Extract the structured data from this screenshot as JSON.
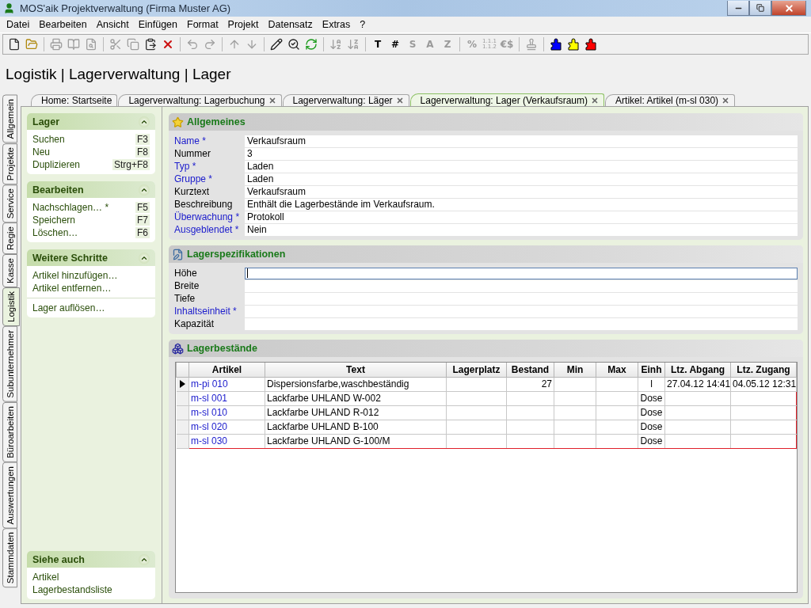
{
  "window": {
    "title": "MOS'aik Projektverwaltung (Firma Muster AG)"
  },
  "menu": [
    "Datei",
    "Bearbeiten",
    "Ansicht",
    "Einfügen",
    "Format",
    "Projekt",
    "Datensatz",
    "Extras",
    "?"
  ],
  "toolbar": {
    "groups": [
      [
        {
          "kind": "icon",
          "disabled": false
        },
        {
          "kind": "icon",
          "disabled": false
        }
      ],
      [
        {
          "kind": "icon",
          "disabled": true
        },
        {
          "kind": "icon",
          "disabled": true
        },
        {
          "kind": "icon",
          "disabled": true
        }
      ],
      [
        {
          "kind": "icon",
          "disabled": true
        },
        {
          "kind": "icon",
          "disabled": true
        },
        {
          "kind": "icon",
          "disabled": false
        },
        {
          "kind": "icon",
          "disabled": false
        }
      ],
      [
        {
          "kind": "icon",
          "disabled": true
        },
        {
          "kind": "icon",
          "disabled": true
        }
      ],
      [
        {
          "kind": "icon",
          "disabled": true
        },
        {
          "kind": "icon",
          "disabled": true
        }
      ],
      [
        {
          "kind": "icon",
          "disabled": false
        },
        {
          "kind": "icon",
          "disabled": false
        },
        {
          "kind": "icon",
          "disabled": false
        }
      ],
      [
        {
          "kind": "icon",
          "disabled": true
        },
        {
          "kind": "icon",
          "disabled": true
        }
      ],
      [
        {
          "kind": "glyph",
          "label": "T",
          "disabled": false
        },
        {
          "kind": "glyph",
          "label": "#",
          "disabled": false
        },
        {
          "kind": "glyph",
          "label": "S",
          "disabled": true
        },
        {
          "kind": "glyph",
          "label": "A",
          "disabled": true
        },
        {
          "kind": "glyph",
          "label": "Z",
          "disabled": true
        }
      ],
      [
        {
          "kind": "glyph",
          "label": "%",
          "disabled": true
        },
        {
          "kind": "glyph",
          "label": "1.1.1 1.1.2",
          "disabled": true
        },
        {
          "kind": "glyph",
          "label": "€$",
          "disabled": true
        }
      ],
      [
        {
          "kind": "icon",
          "disabled": true
        }
      ],
      [
        {
          "kind": "icon",
          "disabled": false,
          "color": "#0000ff"
        },
        {
          "kind": "icon",
          "disabled": false,
          "color": "#ffff00"
        },
        {
          "kind": "icon",
          "disabled": false,
          "color": "#ff0000"
        }
      ]
    ]
  },
  "breadcrumb": "Logistik | Lagerverwaltung | Lager",
  "side_tabs": [
    {
      "label": "Allgemein",
      "selected": false
    },
    {
      "label": "Projekte",
      "selected": false
    },
    {
      "label": "Service",
      "selected": false
    },
    {
      "label": "Regie",
      "selected": false
    },
    {
      "label": "Kasse",
      "selected": false
    },
    {
      "label": "Logistik",
      "selected": true
    },
    {
      "label": "Subunternehmer",
      "selected": false
    },
    {
      "label": "Büroarbeiten",
      "selected": false
    },
    {
      "label": "Auswertungen",
      "selected": false
    },
    {
      "label": "Stammdaten",
      "selected": false
    }
  ],
  "doc_tabs": [
    {
      "label": "Home: Startseite",
      "closable": false,
      "selected": false
    },
    {
      "label": "Lagerverwaltung: Lagerbuchung",
      "closable": true,
      "selected": false
    },
    {
      "label": "Lagerverwaltung: Läger",
      "closable": true,
      "selected": false
    },
    {
      "label": "Lagerverwaltung: Lager (Verkaufsraum)",
      "closable": true,
      "selected": true
    },
    {
      "label": "Artikel: Artikel (m-sl 030)",
      "closable": true,
      "selected": false
    }
  ],
  "task_panels": [
    {
      "title": "Lager",
      "expanded": true,
      "groups": [
        [
          {
            "label": "Suchen",
            "shortcut": "F3"
          },
          {
            "label": "Neu",
            "shortcut": "F8"
          },
          {
            "label": "Duplizieren",
            "shortcut": "Strg+F8"
          }
        ]
      ]
    },
    {
      "title": "Bearbeiten",
      "expanded": true,
      "groups": [
        [
          {
            "label": "Nachschlagen… *",
            "shortcut": "F5"
          },
          {
            "label": "Speichern",
            "shortcut": "F7"
          },
          {
            "label": "Löschen…",
            "shortcut": "F6"
          }
        ]
      ]
    },
    {
      "title": "Weitere Schritte",
      "expanded": true,
      "groups": [
        [
          {
            "label": "Artikel hinzufügen…"
          },
          {
            "label": "Artikel entfernen…"
          }
        ],
        [
          {
            "label": "Lager auflösen…"
          }
        ]
      ]
    }
  ],
  "see_also": {
    "title": "Siehe auch",
    "expanded": true,
    "groups": [
      [
        {
          "label": "Artikel"
        },
        {
          "label": "Lagerbestandsliste"
        }
      ]
    ]
  },
  "sections": [
    {
      "title": "Allgemeines",
      "fields": [
        {
          "label": "Name *",
          "required": true,
          "value": "Verkaufsraum"
        },
        {
          "label": "Nummer",
          "required": false,
          "value": "3"
        },
        {
          "label": "Typ *",
          "required": true,
          "value": "Laden"
        },
        {
          "label": "Gruppe *",
          "required": true,
          "value": "Laden"
        },
        {
          "label": "Kurztext",
          "required": false,
          "value": "Verkaufsraum"
        },
        {
          "label": "Beschreibung",
          "required": false,
          "value": "Enthält die Lagerbestände im Verkaufsraum."
        },
        {
          "label": "Überwachung *",
          "required": true,
          "value": "Protokoll"
        },
        {
          "label": "Ausgeblendet *",
          "required": true,
          "value": "Nein"
        }
      ]
    },
    {
      "title": "Lagerspezifikationen",
      "fields": [
        {
          "label": "Höhe",
          "required": false,
          "focused": true
        },
        {
          "label": "Breite",
          "required": false,
          "focused": false
        },
        {
          "label": "Tiefe",
          "required": false,
          "focused": false
        },
        {
          "label": "Inhaltseinheit *",
          "required": true,
          "focused": false
        },
        {
          "label": "Kapazität",
          "required": false,
          "focused": false
        }
      ]
    }
  ],
  "stock": {
    "title": "Lagerbestände",
    "columns": [
      "Artikel",
      "Text",
      "Lagerplatz",
      "Bestand",
      "Min",
      "Max",
      "Einh",
      "Ltz. Abgang",
      "Ltz. Zugang"
    ],
    "rows": [
      {
        "current": true,
        "selected": false,
        "cells": [
          "m-pi 010",
          "Dispersionsfarbe,waschbeständig",
          null,
          "27",
          null,
          null,
          "l",
          "27.04.12 14:41",
          "04.05.12 12:31"
        ]
      },
      {
        "current": false,
        "selected": true,
        "cells": [
          "m-sl 001",
          "Lackfarbe UHLAND W-002",
          null,
          null,
          null,
          null,
          "Dose",
          null,
          null
        ]
      },
      {
        "current": false,
        "selected": true,
        "cells": [
          "m-sl 010",
          "Lackfarbe UHLAND R-012",
          null,
          null,
          null,
          null,
          "Dose",
          null,
          null
        ]
      },
      {
        "current": false,
        "selected": true,
        "cells": [
          "m-sl 020",
          "Lackfarbe UHLAND B-100",
          null,
          null,
          null,
          null,
          "Dose",
          null,
          null
        ]
      },
      {
        "current": false,
        "selected": true,
        "cells": [
          "m-sl 030",
          "Lackfarbe UHLAND G-100/M",
          null,
          null,
          null,
          null,
          "Dose",
          null,
          null
        ]
      }
    ]
  }
}
